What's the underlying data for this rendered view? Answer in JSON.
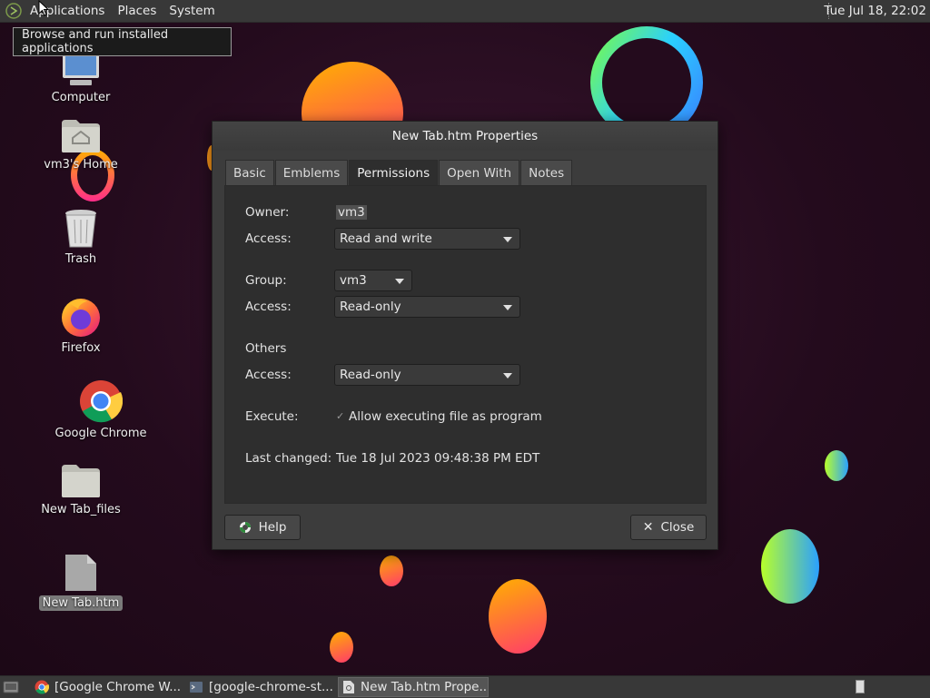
{
  "top_panel": {
    "menus": [
      "Applications",
      "Places",
      "System"
    ],
    "clock": "Tue Jul 18, 22:02"
  },
  "tooltip": "Browse and run installed applications",
  "desktop_icons": [
    {
      "label": "Computer",
      "icon": "computer-icon"
    },
    {
      "label": "vm3's Home",
      "icon": "home-folder-icon"
    },
    {
      "label": "Trash",
      "icon": "trash-icon"
    },
    {
      "label": "Firefox",
      "icon": "firefox-icon"
    },
    {
      "label": "Google Chrome",
      "icon": "chrome-icon"
    },
    {
      "label": "New Tab_files",
      "icon": "folder-icon"
    },
    {
      "label": "New Tab.htm",
      "icon": "file-icon"
    }
  ],
  "dialog": {
    "title": "New Tab.htm Properties",
    "tabs": [
      "Basic",
      "Emblems",
      "Permissions",
      "Open With",
      "Notes"
    ],
    "active_tab": "Permissions",
    "owner_label": "Owner:",
    "owner_value": "vm3",
    "access_label": "Access:",
    "owner_access": "Read and write",
    "group_label": "Group:",
    "group_value": "vm3",
    "group_access": "Read-only",
    "others_label": "Others",
    "others_access": "Read-only",
    "execute_label": "Execute:",
    "execute_checkbox": "Allow executing file as program",
    "last_changed_label": "Last changed:",
    "last_changed_value": "Tue 18 Jul 2023 09:48:38 PM EDT",
    "help_button": "Help",
    "close_button": "Close"
  },
  "taskbar": {
    "tasks": [
      {
        "label": "[Google Chrome W...",
        "icon": "chrome-icon"
      },
      {
        "label": "[google-chrome-st...",
        "icon": "terminal-icon"
      },
      {
        "label": "New Tab.htm Prope...",
        "icon": "file-properties-icon"
      }
    ]
  }
}
